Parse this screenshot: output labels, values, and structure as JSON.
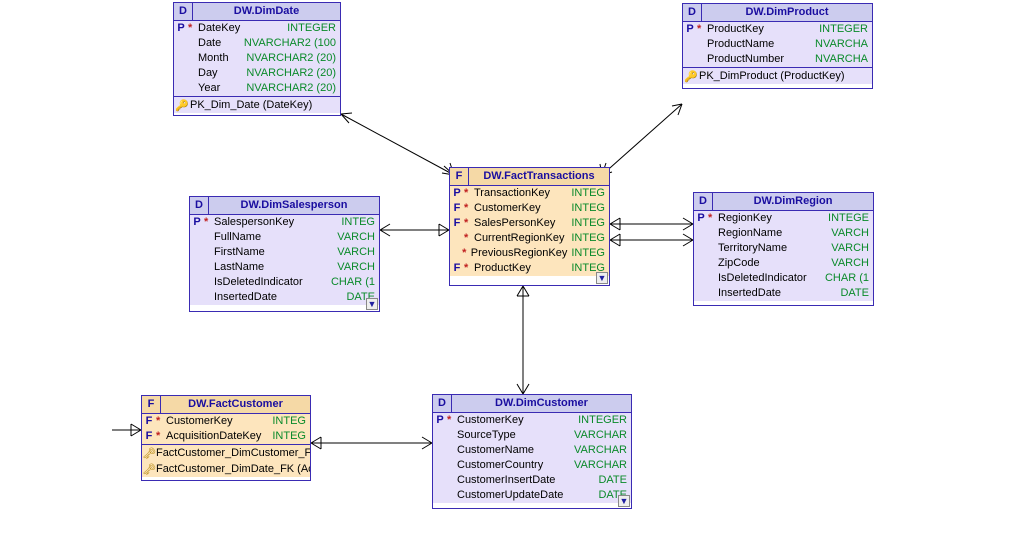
{
  "entities": {
    "dimDate": {
      "kind": "D",
      "title": "DW.DimDate",
      "cols": [
        {
          "flag": "P",
          "req": true,
          "name": "DateKey",
          "type": "INTEGER"
        },
        {
          "flag": "",
          "req": false,
          "name": "Date",
          "type": "NVARCHAR2 (100"
        },
        {
          "flag": "",
          "req": false,
          "name": "Month",
          "type": "NVARCHAR2 (20)"
        },
        {
          "flag": "",
          "req": false,
          "name": "Day",
          "type": "NVARCHAR2 (20)"
        },
        {
          "flag": "",
          "req": false,
          "name": "Year",
          "type": "NVARCHAR2 (20)"
        }
      ],
      "keys": [
        {
          "kind": "pk",
          "label": "PK_Dim_Date (DateKey)"
        }
      ]
    },
    "dimProduct": {
      "kind": "D",
      "title": "DW.DimProduct",
      "cols": [
        {
          "flag": "P",
          "req": true,
          "name": "ProductKey",
          "type": "INTEGER"
        },
        {
          "flag": "",
          "req": false,
          "name": "ProductName",
          "type": "NVARCHA"
        },
        {
          "flag": "",
          "req": false,
          "name": "ProductNumber",
          "type": "NVARCHA"
        }
      ],
      "keys": [
        {
          "kind": "pk",
          "label": "PK_DimProduct (ProductKey)"
        }
      ]
    },
    "factTransactions": {
      "kind": "F",
      "title": "DW.FactTransactions",
      "cols": [
        {
          "flag": "P",
          "req": true,
          "name": "TransactionKey",
          "type": "INTEG"
        },
        {
          "flag": "F",
          "req": true,
          "name": "CustomerKey",
          "type": "INTEG"
        },
        {
          "flag": "F",
          "req": true,
          "name": "SalesPersonKey",
          "type": "INTEG"
        },
        {
          "flag": "",
          "req": true,
          "name": "CurrentRegionKey",
          "type": "INTEG"
        },
        {
          "flag": "",
          "req": true,
          "name": "PreviousRegionKey",
          "type": "INTEG"
        },
        {
          "flag": "F",
          "req": true,
          "name": "ProductKey",
          "type": "INTEG"
        }
      ],
      "keys": []
    },
    "dimSalesperson": {
      "kind": "D",
      "title": "DW.DimSalesperson",
      "cols": [
        {
          "flag": "P",
          "req": true,
          "name": "SalespersonKey",
          "type": "INTEG"
        },
        {
          "flag": "",
          "req": false,
          "name": "FullName",
          "type": "VARCH"
        },
        {
          "flag": "",
          "req": false,
          "name": "FirstName",
          "type": "VARCH"
        },
        {
          "flag": "",
          "req": false,
          "name": "LastName",
          "type": "VARCH"
        },
        {
          "flag": "",
          "req": false,
          "name": "IsDeletedIndicator",
          "type": "CHAR (1"
        },
        {
          "flag": "",
          "req": false,
          "name": "InsertedDate",
          "type": "DATE"
        }
      ],
      "keys": []
    },
    "dimRegion": {
      "kind": "D",
      "title": "DW.DimRegion",
      "cols": [
        {
          "flag": "P",
          "req": true,
          "name": "RegionKey",
          "type": "INTEGE"
        },
        {
          "flag": "",
          "req": false,
          "name": "RegionName",
          "type": "VARCH"
        },
        {
          "flag": "",
          "req": false,
          "name": "TerritoryName",
          "type": "VARCH"
        },
        {
          "flag": "",
          "req": false,
          "name": "ZipCode",
          "type": "VARCH"
        },
        {
          "flag": "",
          "req": false,
          "name": "IsDeletedIndicator",
          "type": "CHAR (1"
        },
        {
          "flag": "",
          "req": false,
          "name": "InsertedDate",
          "type": "DATE"
        }
      ],
      "keys": []
    },
    "factCustomer": {
      "kind": "F",
      "title": "DW.FactCustomer",
      "cols": [
        {
          "flag": "F",
          "req": true,
          "name": "CustomerKey",
          "type": "INTEG"
        },
        {
          "flag": "F",
          "req": true,
          "name": "AcquisitionDateKey",
          "type": "INTEG"
        }
      ],
      "keys": [
        {
          "kind": "fk",
          "label": "FactCustomer_DimCustomer_FK"
        },
        {
          "kind": "fk",
          "label": "FactCustomer_DimDate_FK (Ac"
        }
      ]
    },
    "dimCustomer": {
      "kind": "D",
      "title": "DW.DimCustomer",
      "cols": [
        {
          "flag": "P",
          "req": true,
          "name": "CustomerKey",
          "type": "INTEGER"
        },
        {
          "flag": "",
          "req": false,
          "name": "SourceType",
          "type": "VARCHAR"
        },
        {
          "flag": "",
          "req": false,
          "name": "CustomerName",
          "type": "VARCHAR"
        },
        {
          "flag": "",
          "req": false,
          "name": "CustomerCountry",
          "type": "VARCHAR"
        },
        {
          "flag": "",
          "req": false,
          "name": "CustomerInsertDate",
          "type": "DATE"
        },
        {
          "flag": "",
          "req": false,
          "name": "CustomerUpdateDate",
          "type": "DATE"
        }
      ],
      "keys": []
    }
  }
}
